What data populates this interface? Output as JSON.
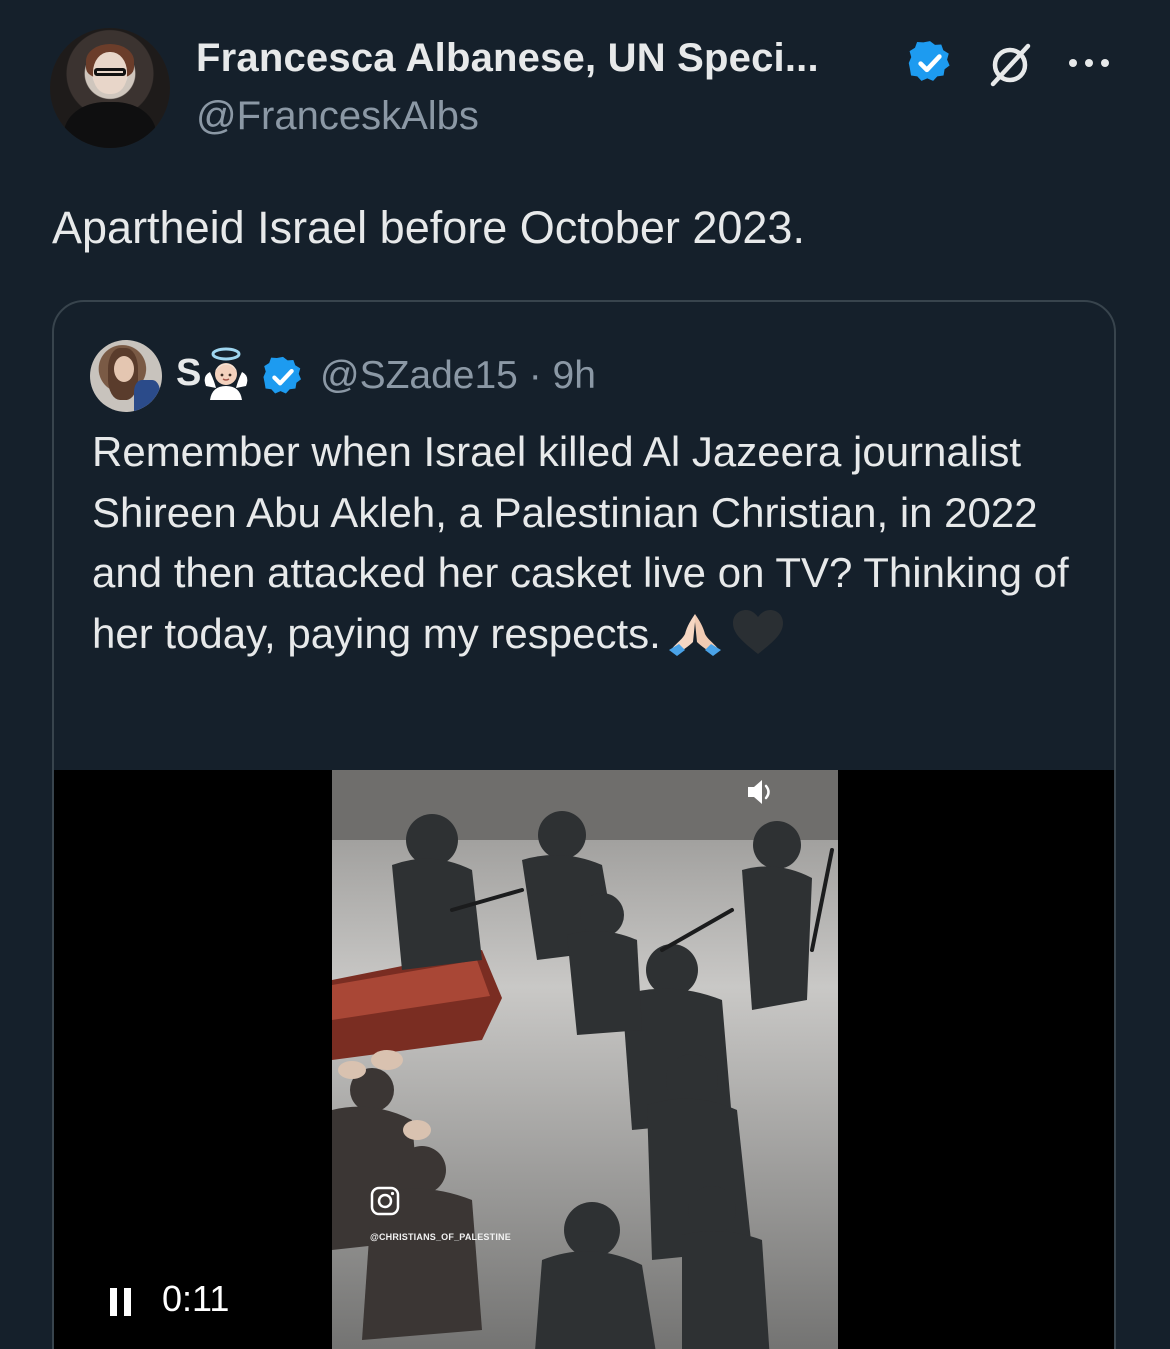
{
  "author": {
    "display_name": "Francesca Albanese, UN Speci...",
    "handle": "@FranceskAlbs"
  },
  "tweet": {
    "text": "Apartheid Israel before October 2023."
  },
  "quoted_tweet": {
    "name": "S",
    "handle_time": "@SZade15 · 9h",
    "text": "Remember when Israel killed Al Jazeera journalist Shireen Abu Akleh, a Palestinian Christian, in 2022 and then attacked her casket live on TV? Thinking of her today, paying my respects.",
    "emojis": [
      "praying-hands-emoji",
      "black-heart-emoji"
    ],
    "video": {
      "watermark": "@CHRISTIANS_OF_PALESTINE",
      "elapsed_time": "0:11"
    }
  },
  "colors": {
    "background": "#15202b",
    "text_primary": "#e7e9ea",
    "text_secondary": "#8b98a5",
    "verified_blue": "#1d9bf0",
    "border": "#38444d"
  },
  "icons": [
    "verified-badge-icon",
    "grok-icon",
    "more-options-icon",
    "angel-emoji-icon",
    "volume-icon",
    "instagram-icon",
    "pause-icon"
  ]
}
